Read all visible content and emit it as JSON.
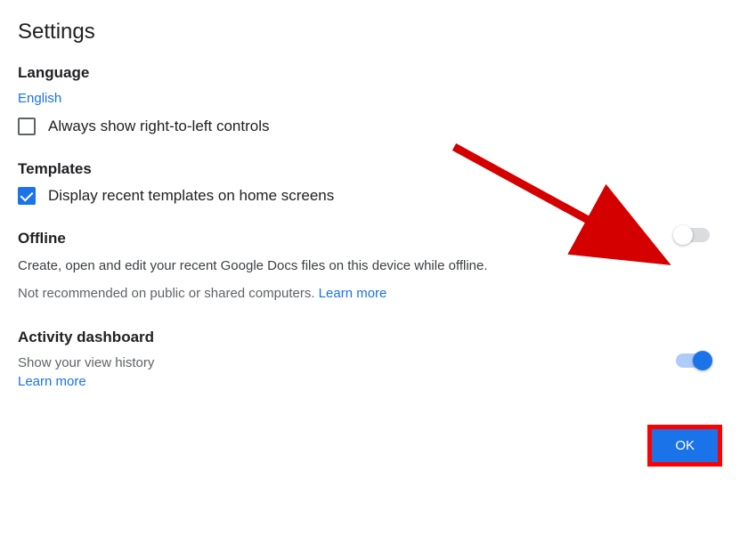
{
  "title": "Settings",
  "language": {
    "heading": "Language",
    "value": "English",
    "rtl_label": "Always show right-to-left controls"
  },
  "templates": {
    "heading": "Templates",
    "display_label": "Display recent templates on home screens"
  },
  "offline": {
    "heading": "Offline",
    "description": "Create, open and edit your recent Google Docs files on this device while offline.",
    "warning": "Not recommended on public or shared computers. ",
    "learn_more": "Learn more"
  },
  "activity": {
    "heading": "Activity dashboard",
    "sub": "Show your view history",
    "learn_more": "Learn more"
  },
  "ok_label": "OK"
}
